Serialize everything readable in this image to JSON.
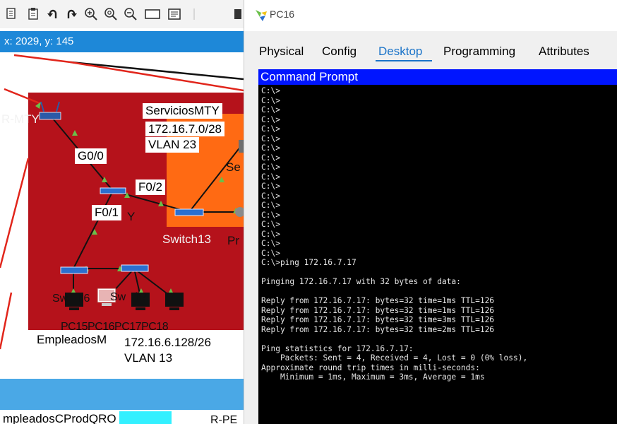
{
  "toolbar": {
    "icons": [
      "copy-icon",
      "paste-icon",
      "undo-icon",
      "redo-icon",
      "zoom-in-icon",
      "zoom-reset-icon",
      "zoom-out-icon",
      "rectangle-icon",
      "notes-icon"
    ]
  },
  "coords": {
    "text": "x: 2029, y: 145"
  },
  "canvas": {
    "router_label": "R-MTY",
    "g00": "G0/0",
    "f02": "F0/2",
    "f01": "F0/1",
    "y_partial": "Y",
    "servicios_title": "ServiciosMTY",
    "servicios_net": "172.16.7.0/28",
    "servicios_vlan": "VLAN 23",
    "se_partial": "Se",
    "switch13": "Switch13",
    "pr_partial": "Pr",
    "switch16_partial": "Sw   h6",
    "switch17_partial": "Sw   h7",
    "pc_labels": "PC15PC16PC17PC18",
    "empleados_mty": "EmpleadosM",
    "empleados_net": "172.16.6.128/26",
    "empleados_vlan": "VLAN 13",
    "empleados_qro": "mpleadosCProdQRO",
    "r_partial": "R-PE",
    "colors": {
      "red_area": "#b5121b",
      "orange_area": "#ff6a13",
      "blue_bar": "#1e88d8",
      "cmd_title": "#0015ff"
    }
  },
  "window": {
    "title": "PC16",
    "tabs": [
      "Physical",
      "Config",
      "Desktop",
      "Programming",
      "Attributes"
    ],
    "active_tab": "Desktop",
    "cmd_title": "Command Prompt",
    "terminal_lines": [
      "C:\\>",
      "C:\\>",
      "C:\\>",
      "C:\\>",
      "C:\\>",
      "C:\\>",
      "C:\\>",
      "C:\\>",
      "C:\\>",
      "C:\\>",
      "C:\\>",
      "C:\\>",
      "C:\\>",
      "C:\\>",
      "C:\\>",
      "C:\\>",
      "C:\\>",
      "C:\\>",
      "C:\\>ping 172.16.7.17",
      "",
      "Pinging 172.16.7.17 with 32 bytes of data:",
      "",
      "Reply from 172.16.7.17: bytes=32 time=1ms TTL=126",
      "Reply from 172.16.7.17: bytes=32 time=1ms TTL=126",
      "Reply from 172.16.7.17: bytes=32 time=3ms TTL=126",
      "Reply from 172.16.7.17: bytes=32 time=2ms TTL=126",
      "",
      "Ping statistics for 172.16.7.17:",
      "    Packets: Sent = 4, Received = 4, Lost = 0 (0% loss),",
      "Approximate round trip times in milli-seconds:",
      "    Minimum = 1ms, Maximum = 3ms, Average = 1ms"
    ]
  }
}
